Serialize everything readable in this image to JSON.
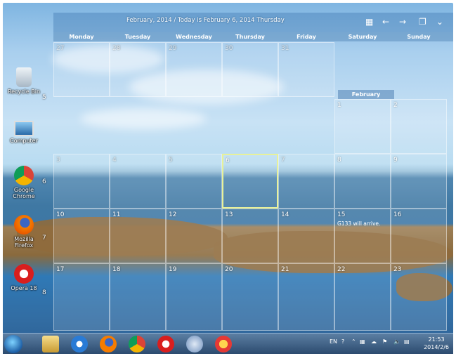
{
  "calendar": {
    "title": "February, 2014 / Today is February 6, 2014 Thursday",
    "weekdays": [
      "Monday",
      "Tuesday",
      "Wednesday",
      "Thursday",
      "Friday",
      "Saturday",
      "Sunday"
    ],
    "month_label": "February",
    "week_numbers": [
      "5",
      "6",
      "7",
      "8"
    ],
    "event_text": "G133 will arrive."
  },
  "desktop": {
    "icons": [
      "Recycle Bin",
      "Computer",
      "Google Chrome",
      "Mozilla Firefox",
      "Opera 18"
    ]
  },
  "taskbar": {
    "lang": "EN",
    "time": "21:53",
    "date": "2014/2/6"
  }
}
